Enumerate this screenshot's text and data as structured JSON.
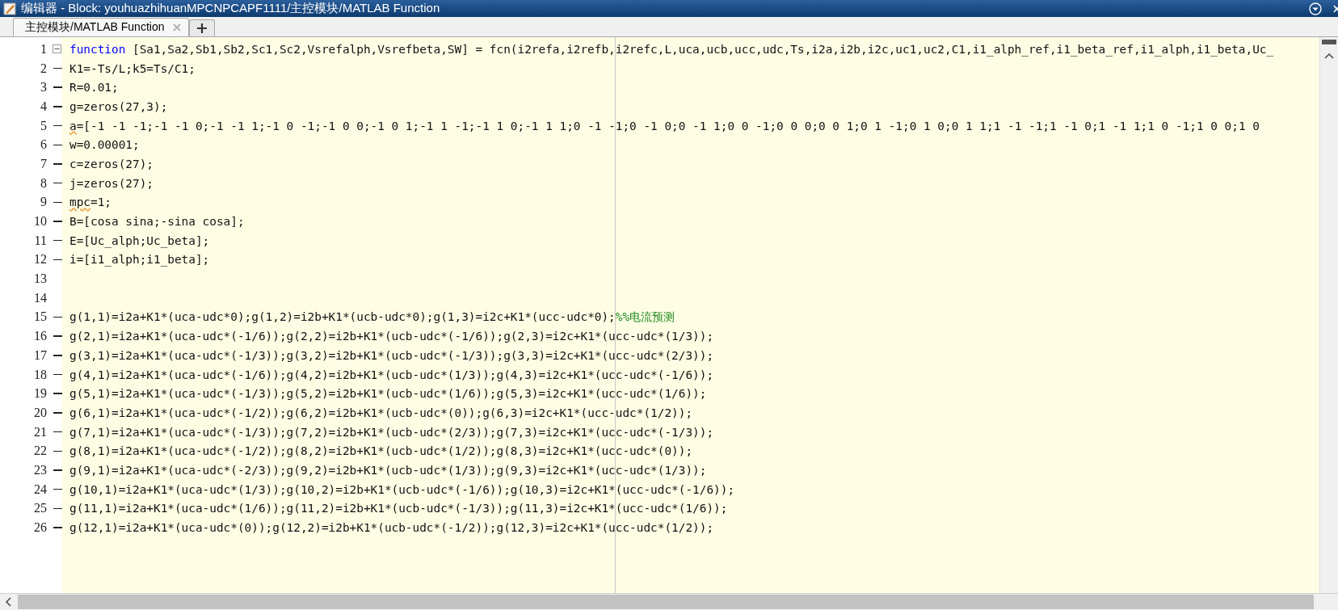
{
  "window": {
    "title": "编辑器 - Block: youhuazhihuanMPCNPCAPF1111/主控模块/MATLAB Function"
  },
  "tabs": [
    {
      "label": "主控模块/MATLAB Function",
      "selected": true
    }
  ],
  "editor": {
    "lines": [
      {
        "number": "1",
        "foldable": true,
        "executable": false,
        "segments": [
          {
            "kind": "keyword",
            "text": "function"
          },
          {
            "kind": "code",
            "text": "[Sa1,Sa2,Sb1,Sb2,Sc1,Sc2,Vsrefalph,Vsrefbeta,SW] = fcn(i2refa,i2refb,i2refc,L,uca,ucb,ucc,udc,Ts,i2a,i2b,i2c,uc1,uc2,C1,i1_alph_ref,i1_beta_ref,i1_alph,i1_beta,Uc_"
          }
        ]
      },
      {
        "number": "2",
        "foldable": false,
        "executable": true,
        "segments": [
          {
            "kind": "code",
            "text": "K1=-Ts/L;k5=Ts/C1;"
          }
        ]
      },
      {
        "number": "3",
        "foldable": false,
        "executable": true,
        "segments": [
          {
            "kind": "code",
            "text": "R=0.01;"
          }
        ]
      },
      {
        "number": "4",
        "foldable": false,
        "executable": true,
        "segments": [
          {
            "kind": "code",
            "text": "g=zeros(27,3);"
          }
        ]
      },
      {
        "number": "5",
        "foldable": false,
        "executable": true,
        "segments": [
          {
            "kind": "warning",
            "text": "a"
          },
          {
            "kind": "code",
            "text": "=[-1 -1 -1;-1 -1 0;-1 -1 1;-1 0 -1;-1 0 0;-1 0 1;-1 1 -1;-1 1 0;-1 1 1;0 -1 -1;0 -1 0;0 -1 1;0 0 -1;0 0 0;0 0 1;0 1 -1;0 1 0;0 1 1;1 -1 -1;1 -1 0;1 -1 1;1 0 -1;1 0 0;1 0"
          }
        ]
      },
      {
        "number": "6",
        "foldable": false,
        "executable": true,
        "segments": [
          {
            "kind": "code",
            "text": "w=0.00001;"
          }
        ]
      },
      {
        "number": "7",
        "foldable": false,
        "executable": true,
        "segments": [
          {
            "kind": "code",
            "text": "c=zeros(27);"
          }
        ]
      },
      {
        "number": "8",
        "foldable": false,
        "executable": true,
        "segments": [
          {
            "kind": "code",
            "text": "j=zeros(27);"
          }
        ]
      },
      {
        "number": "9",
        "foldable": false,
        "executable": true,
        "segments": [
          {
            "kind": "warning",
            "text": "mpc"
          },
          {
            "kind": "code",
            "text": "=1;"
          }
        ]
      },
      {
        "number": "10",
        "foldable": false,
        "executable": true,
        "segments": [
          {
            "kind": "code",
            "text": "B=[cosa sina;-sina cosa];"
          }
        ]
      },
      {
        "number": "11",
        "foldable": false,
        "executable": true,
        "segments": [
          {
            "kind": "code",
            "text": "E=[Uc_alph;Uc_beta];"
          }
        ]
      },
      {
        "number": "12",
        "foldable": false,
        "executable": true,
        "segments": [
          {
            "kind": "code",
            "text": "i=[i1_alph;i1_beta];"
          }
        ]
      },
      {
        "number": "13",
        "foldable": false,
        "executable": false
      },
      {
        "number": "14",
        "foldable": false,
        "executable": false
      },
      {
        "number": "15",
        "foldable": false,
        "executable": true,
        "segments": [
          {
            "kind": "code",
            "text": "g(1,1)=i2a+K1*(uca-udc*0);g(1,2)=i2b+K1*(ucb-udc*0);g(1,3)=i2c+K1*(ucc-udc*0);"
          },
          {
            "kind": "comment",
            "text": "%%电流预测"
          }
        ]
      },
      {
        "number": "16",
        "foldable": false,
        "executable": true,
        "segments": [
          {
            "kind": "code",
            "text": "g(2,1)=i2a+K1*(uca-udc*(-1/6));g(2,2)=i2b+K1*(ucb-udc*(-1/6));g(2,3)=i2c+K1*(ucc-udc*(1/3));"
          }
        ]
      },
      {
        "number": "17",
        "foldable": false,
        "executable": true,
        "segments": [
          {
            "kind": "code",
            "text": "g(3,1)=i2a+K1*(uca-udc*(-1/3));g(3,2)=i2b+K1*(ucb-udc*(-1/3));g(3,3)=i2c+K1*(ucc-udc*(2/3));"
          }
        ]
      },
      {
        "number": "18",
        "foldable": false,
        "executable": true,
        "segments": [
          {
            "kind": "code",
            "text": "g(4,1)=i2a+K1*(uca-udc*(-1/6));g(4,2)=i2b+K1*(ucb-udc*(1/3));g(4,3)=i2c+K1*(ucc-udc*(-1/6));"
          }
        ]
      },
      {
        "number": "19",
        "foldable": false,
        "executable": true,
        "segments": [
          {
            "kind": "code",
            "text": "g(5,1)=i2a+K1*(uca-udc*(-1/3));g(5,2)=i2b+K1*(ucb-udc*(1/6));g(5,3)=i2c+K1*(ucc-udc*(1/6));"
          }
        ]
      },
      {
        "number": "20",
        "foldable": false,
        "executable": true,
        "segments": [
          {
            "kind": "code",
            "text": "g(6,1)=i2a+K1*(uca-udc*(-1/2));g(6,2)=i2b+K1*(ucb-udc*(0));g(6,3)=i2c+K1*(ucc-udc*(1/2));"
          }
        ]
      },
      {
        "number": "21",
        "foldable": false,
        "executable": true,
        "segments": [
          {
            "kind": "code",
            "text": "g(7,1)=i2a+K1*(uca-udc*(-1/3));g(7,2)=i2b+K1*(ucb-udc*(2/3));g(7,3)=i2c+K1*(ucc-udc*(-1/3));"
          }
        ]
      },
      {
        "number": "22",
        "foldable": false,
        "executable": true,
        "segments": [
          {
            "kind": "code",
            "text": "g(8,1)=i2a+K1*(uca-udc*(-1/2));g(8,2)=i2b+K1*(ucb-udc*(1/2));g(8,3)=i2c+K1*(ucc-udc*(0));"
          }
        ]
      },
      {
        "number": "23",
        "foldable": false,
        "executable": true,
        "segments": [
          {
            "kind": "code",
            "text": "g(9,1)=i2a+K1*(uca-udc*(-2/3));g(9,2)=i2b+K1*(ucb-udc*(1/3));g(9,3)=i2c+K1*(ucc-udc*(1/3));"
          }
        ]
      },
      {
        "number": "24",
        "foldable": false,
        "executable": true,
        "segments": [
          {
            "kind": "code",
            "text": "g(10,1)=i2a+K1*(uca-udc*(1/3));g(10,2)=i2b+K1*(ucb-udc*(-1/6));g(10,3)=i2c+K1*(ucc-udc*(-1/6));"
          }
        ]
      },
      {
        "number": "25",
        "foldable": false,
        "executable": true,
        "segments": [
          {
            "kind": "code",
            "text": "g(11,1)=i2a+K1*(uca-udc*(1/6));g(11,2)=i2b+K1*(ucb-udc*(-1/3));g(11,3)=i2c+K1*(ucc-udc*(1/6));"
          }
        ]
      },
      {
        "number": "26",
        "foldable": false,
        "executable": true,
        "segments": [
          {
            "kind": "code",
            "text": "g(12,1)=i2a+K1*(uca-udc*(0));g(12,2)=i2b+K1*(ucb-udc*(-1/2));g(12,3)=i2c+K1*(ucc-udc*(1/2));"
          }
        ]
      }
    ]
  }
}
